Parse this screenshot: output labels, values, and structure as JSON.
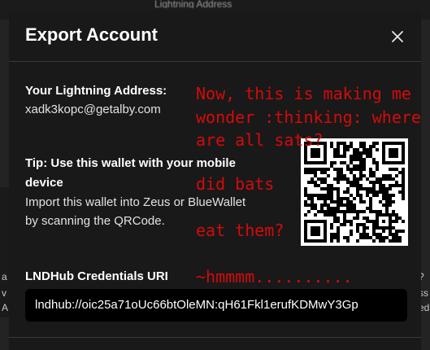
{
  "background": {
    "header_text": "Lightning Address",
    "left_letters": [
      "a",
      "v",
      "A"
    ],
    "right_letters": [
      "?",
      "ss",
      "ed"
    ]
  },
  "modal": {
    "title": "Export Account",
    "close_icon": "close-icon",
    "lightning_address": {
      "label": "Your Lightning Address:",
      "value": "xadk3kopc@getalby.com"
    },
    "tip": {
      "label_line1": "Tip: Use this wallet with your mobile",
      "label_line2": "device",
      "text_line1": "Import this wallet into Zeus or BlueWallet",
      "text_line2": "by scanning the QRCode."
    },
    "credentials": {
      "label": "LNDHub Credentials URI",
      "value": "lndhub://oic25a71oUc66btOleMN:qH61Fkl1erufKDMwY3Gp"
    }
  },
  "annotations": {
    "line1": "Now, this is making me",
    "line2": "wonder :thinking: where",
    "line3": "are all sats?",
    "line4": "did bats",
    "line5": "eat them?",
    "line6": "~hmmmm.........."
  },
  "colors": {
    "modal_bg": "#191919",
    "annotation": "#d60a0a",
    "field_bg": "#000000"
  }
}
